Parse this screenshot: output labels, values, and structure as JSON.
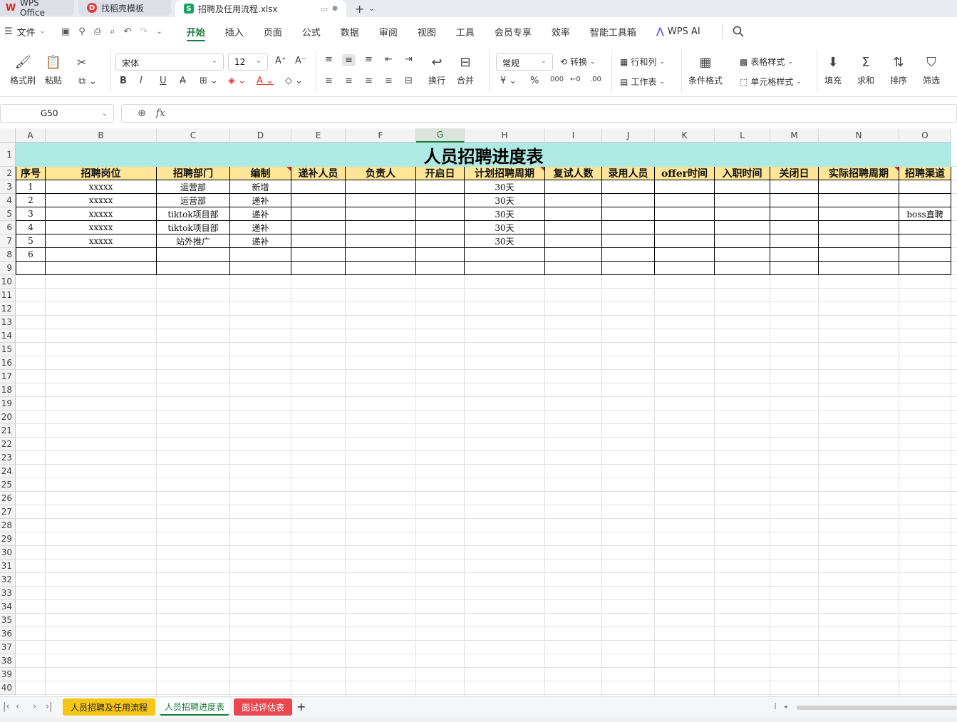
{
  "tabs": {
    "wps": "WPS Office",
    "template": "找稻壳模板",
    "file": "招聘及任用流程.xlsx"
  },
  "menu": {
    "file": "文件",
    "items": [
      "开始",
      "插入",
      "页面",
      "公式",
      "数据",
      "审阅",
      "视图",
      "工具",
      "会员专享",
      "效率",
      "智能工具箱"
    ],
    "ai": "WPS AI"
  },
  "ribbon": {
    "format_painter": "格式刷",
    "paste": "粘贴",
    "font": "宋体",
    "size": "12",
    "wrap": "换行",
    "merge": "合并",
    "number_format": "常规",
    "convert": "转换",
    "row_col": "行和列",
    "worksheet": "工作表",
    "cond_format": "条件格式",
    "table_style": "表格样式",
    "cell_style": "单元格样式",
    "fill": "填充",
    "sum": "求和",
    "sort": "排序",
    "filter": "筛选"
  },
  "formula": {
    "cell_ref": "G50",
    "fx": "fx"
  },
  "sheet": {
    "columns": [
      "A",
      "B",
      "C",
      "D",
      "E",
      "F",
      "G",
      "H",
      "I",
      "J",
      "K",
      "L",
      "M",
      "N",
      "O"
    ],
    "selected_column": "G",
    "title": "人员招聘进度表",
    "headers": [
      "序号",
      "招聘岗位",
      "招聘部门",
      "编制",
      "递补人员",
      "负责人",
      "开启日",
      "计划招聘周期",
      "复试人数",
      "录用人员",
      "offer时间",
      "入职时间",
      "关闭日",
      "实际招聘周期",
      "招聘渠道"
    ],
    "rows": [
      [
        "1",
        "xxxxx",
        "运营部",
        "新增",
        "",
        "",
        "",
        "30天",
        "",
        "",
        "",
        "",
        "",
        "",
        ""
      ],
      [
        "2",
        "xxxxx",
        "运营部",
        "递补",
        "",
        "",
        "",
        "30天",
        "",
        "",
        "",
        "",
        "",
        "",
        ""
      ],
      [
        "3",
        "xxxxx",
        "tiktok项目部",
        "递补",
        "",
        "",
        "",
        "30天",
        "",
        "",
        "",
        "",
        "",
        "",
        "boss直聘"
      ],
      [
        "4",
        "xxxxx",
        "tiktok项目部",
        "递补",
        "",
        "",
        "",
        "30天",
        "",
        "",
        "",
        "",
        "",
        "",
        ""
      ],
      [
        "5",
        "xxxxx",
        "站外推广",
        "递补",
        "",
        "",
        "",
        "30天",
        "",
        "",
        "",
        "",
        "",
        "",
        ""
      ],
      [
        "6",
        "",
        "",
        "",
        "",
        "",
        "",
        "",
        "",
        "",
        "",
        "",
        "",
        "",
        ""
      ],
      [
        "",
        "",
        "",
        "",
        "",
        "",
        "",
        "",
        "",
        "",
        "",
        "",
        "",
        "",
        ""
      ]
    ]
  },
  "sheet_tabs": [
    "人员招聘及任用流程",
    "人员招聘进度表",
    "面试评估表"
  ]
}
